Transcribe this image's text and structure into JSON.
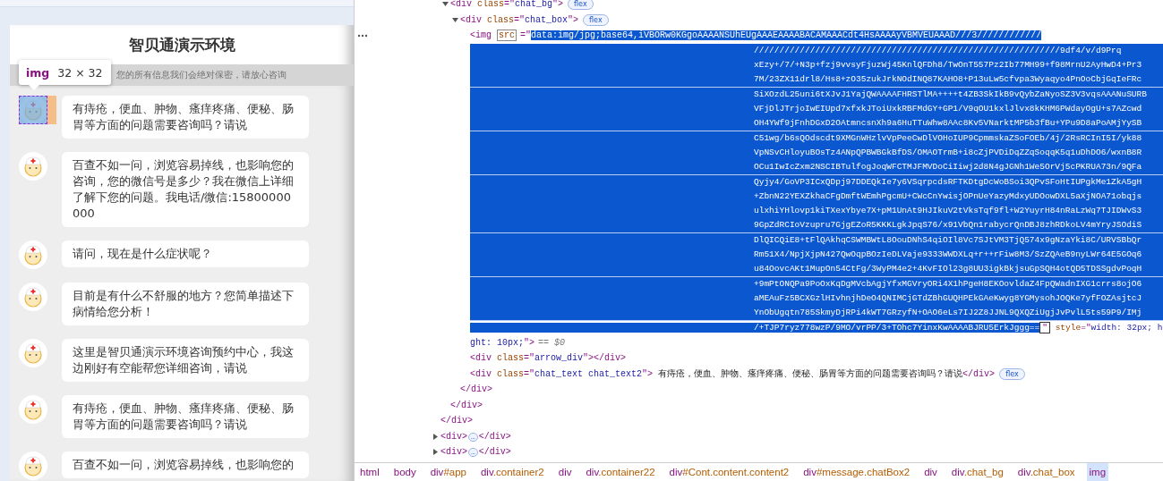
{
  "page": {
    "title": "智贝通演示环境",
    "notice": "您的所有信息我们会绝对保密，请放心咨询",
    "tooltip": {
      "tag": "img",
      "size": "32 × 32"
    },
    "messages": [
      {
        "text": "有痔疮，便血、肿物、瘙痒疼痛、便秘、肠胃等方面的问题需要咨询吗？请说",
        "highlighted": true
      },
      {
        "text": "百查不如一问，浏览容易掉线，也影响您的咨询，您的微信号是多少？我在微信上详细了解下您的问题。我电话/微信:15800000000",
        "highlighted": false
      },
      {
        "text": "请问，现在是什么症状呢？",
        "highlighted": false
      },
      {
        "text": "目前是有什么不舒服的地方？您简单描述下病情给您分析！",
        "highlighted": false
      },
      {
        "text": "这里是智贝通演示环境咨询预约中心，我这边刚好有空能帮您详细咨询，请说",
        "highlighted": false
      },
      {
        "text": "有痔疮，便血、肿物、瘙痒疼痛、便秘、肠胃等方面的问题需要咨询吗？请说",
        "highlighted": false
      },
      {
        "text": "百查不如一问，浏览容易掉线，也影响您的",
        "highlighted": false
      }
    ]
  },
  "elements": {
    "tree": [
      {
        "kind": "element",
        "close": [
          {
            "kind": "tag",
            "text": "</div>"
          }
        ],
        "children": [
          {
            "kind": "element",
            "expanded": true,
            "badge": "flex",
            "line": [
              {
                "kind": "tag",
                "text": "<div "
              },
              {
                "kind": "attr",
                "text": "class"
              },
              {
                "kind": "tag",
                "text": "=\""
              },
              {
                "kind": "value",
                "text": "chat_bg"
              },
              {
                "kind": "tag",
                "text": "\">"
              }
            ],
            "close": [
              {
                "kind": "tag",
                "text": "</div>"
              }
            ],
            "children": [
              {
                "kind": "element",
                "expanded": true,
                "badge": "flex",
                "line": [
                  {
                    "kind": "tag",
                    "text": "<div "
                  },
                  {
                    "kind": "attr",
                    "text": "class"
                  },
                  {
                    "kind": "tag",
                    "text": "=\""
                  },
                  {
                    "kind": "value",
                    "text": "chat_box"
                  },
                  {
                    "kind": "tag",
                    "text": "\">"
                  }
                ],
                "close": [
                  {
                    "kind": "tag",
                    "text": "</div>"
                  }
                ],
                "children": [
                  {
                    "kind": "img",
                    "selected": true,
                    "open": "<img ",
                    "attr": "src",
                    "eq": "=\"",
                    "src_first": "data:img/jpg;base64,iVBORw0KGgoAAAANSUhEUgAAAEAAAABACAMAAACdt4HsAAAAyVBMVEUAAAD///3////////////",
                    "src_groups": [
                      [
                        "////////////////////////////////////////////////////////////9df4/v/d9Prq",
                        "xEzy+/7/+N3p+fzj9vvsyFjuzWj45KnlQFDh8/TwOnT557Pz2Ib77MH99+f98MrnU2AyHwD4+Pr3",
                        "7M/23ZX11drl8/Hs8+zO35zukJrkNOdINQ87KAHO8+P13uLw5cfvpa3Wyaqyo4PnOoCbjGqIeFRc"
                      ],
                      [
                        "SiXOzdL25uni6tXJvJ1YajQWAAAAFHRSTlMA++++t4ZB3SkIkB9vQybZaNyoSZ3V3vqsAAANuSURB",
                        "VFjDlJTrjoIwEIUpd7xfxkJToiUxkRBFMdGY+GP1/V9qOU1kxlJlvx8kKHM6PWdayOgU+s7AZcwd",
                        "OH4YWf9jFnhDGxD2OAtmncsnXh9a6HuTTuWhw8AAc8Kv5VNarktMP5b3fBu+YPu9D8aPoAMjYySB"
                      ],
                      [
                        "C51wg/b6sQOdscdt9XMGnWHzlvVpPeeCwDlVOHoIUP9CpmmskaZSoFOEb/4j/2RsRCInI5I/yk88",
                        "VpNSvCHloyuBOsTz4ANpQPBWBGkBfDS/OMAOTrmB+i8cZjPVDiDqZZqSoqqK5q1uDhDO6/wxnB8R",
                        "OCu1IwIcZxm2NSCIBTulfogJoqWFCTMJFMVDoCiIiwj2d8N4gJGNh1We5OrVj5cPKRUA73n/9QFa"
                      ],
                      [
                        "Qyjy4/GoVP3ICxQDpj97DDEQkIe7y6VSqrpcdsRFTKDtgDcWoBSoi3QPvSFoHtIUPgkMe1ZkA5gH",
                        "+ZbnN22YEXZkhaCFgDmftWEmhPgcmU+CWcCnYwisjOPnUeYazyMdxyUDOowDXL5aXjNOA71obqjs",
                        "ulxhiYHlovp1kiTXexYbye7X+pM1UnAt9HJIkuV2tVksTqf9fl+W2YuyrH84nRaLzWq7TJIDWvS3",
                        "9GpZdRCIoVzupru7GjgEZoR5KKKLgkJpqS76/x91VbQn1rabycrQnDBJ8zhRDkoLV4mYryJSOdiS"
                      ],
                      [
                        "DlQICQiE8+tFlQAkhqCSWMBWtL8OouDNhS4qiOIl8Vc7SJtVM3TjQ574x9gNzaYki8C/URVSBbQr",
                        "Rm51X4/NpjXjpN427QwOqpBOzIeDLVaje9333WWDXLq+r++rFiw8M3/SzZQAeB9nyLWr64E5GOq6",
                        "u84OovcAKt1MupOn54CtFg/3WyPM4e2+4KvFIOl23g8UU3igkBkjsuGpSQH4otQD5TDSSgdvPoqH"
                      ],
                      [
                        "+9mPtONQPa9PoOxKqDgMVcbAgjYfxMGVryORi4X1hPgeH8EKOovldaZ4FpQWadnIXG1crrs8ojO6",
                        "aMEAuFz5BCXGzlHIvhnjhDeO4QNIMCjGTdZBhGUQHPEkGAeKwyg8YGMysohJOQKe7yfFOZAsjtcJ",
                        "YnObUgqtn785SkmyDjRPi4kWT7GRzyfN+OAO6eLs7IJ2Z8JJNL9QXQZiUgjJvPvlL5ts59P9/IMj"
                      ],
                      [
                        "/+TJP7ryz778wzP/9MO/vrPP/3+TOhc7YinxKwAAAABJRU5ErkJggg=="
                      ]
                    ],
                    "quote": "\"",
                    "style_attr": "style",
                    "style_eq": "=\"",
                    "style_start": "width: 32px; h",
                    "style_end": "ght: 10px;",
                    "end": "\">",
                    "console_ref": "== $0"
                  },
                  {
                    "kind": "element",
                    "line": [
                      {
                        "kind": "tag",
                        "text": "<div "
                      },
                      {
                        "kind": "attr",
                        "text": "class"
                      },
                      {
                        "kind": "tag",
                        "text": "=\""
                      },
                      {
                        "kind": "value",
                        "text": "arrow_div"
                      },
                      {
                        "kind": "tag",
                        "text": "\"></div>"
                      }
                    ]
                  },
                  {
                    "kind": "element",
                    "badge": "flex",
                    "line": [
                      {
                        "kind": "tag",
                        "text": "<div "
                      },
                      {
                        "kind": "attr",
                        "text": "class"
                      },
                      {
                        "kind": "tag",
                        "text": "=\""
                      },
                      {
                        "kind": "value",
                        "text": "chat_text chat_text2"
                      },
                      {
                        "kind": "tag",
                        "text": "\">"
                      },
                      {
                        "kind": "text",
                        "text": " 有痔疮，便血、肿物、瘙痒疼痛、便秘、肠胃等方面的问题需要咨询吗？请说"
                      },
                      {
                        "kind": "tag",
                        "text": "</div>"
                      }
                    ]
                  }
                ]
              }
            ]
          }
        ]
      },
      {
        "kind": "element",
        "expanded": false,
        "line": [
          {
            "kind": "tag",
            "text": "<div>"
          },
          {
            "kind": "ellipsis",
            "text": "…"
          },
          {
            "kind": "tag",
            "text": "</div>"
          }
        ]
      },
      {
        "kind": "element",
        "expanded": false,
        "line": [
          {
            "kind": "tag",
            "text": "<div>"
          },
          {
            "kind": "ellipsis",
            "text": "…"
          },
          {
            "kind": "tag",
            "text": "</div>"
          }
        ]
      }
    ],
    "breadcrumbs": [
      {
        "tag": "html",
        "selected": false
      },
      {
        "tag": "body",
        "selected": false
      },
      {
        "tag": "div",
        "rest": "#app",
        "selected": false
      },
      {
        "tag": "div",
        "rest": ".container2",
        "selected": false
      },
      {
        "tag": "div",
        "selected": false
      },
      {
        "tag": "div",
        "rest": ".container22",
        "selected": false
      },
      {
        "tag": "div",
        "rest": "#Cont.content.content2",
        "selected": false
      },
      {
        "tag": "div",
        "rest": "#message.chatBox2",
        "selected": false
      },
      {
        "tag": "div",
        "selected": false
      },
      {
        "tag": "div",
        "rest": ".chat_bg",
        "selected": false
      },
      {
        "tag": "div",
        "rest": ".chat_box",
        "selected": false
      },
      {
        "tag": "img",
        "selected": true
      }
    ]
  }
}
